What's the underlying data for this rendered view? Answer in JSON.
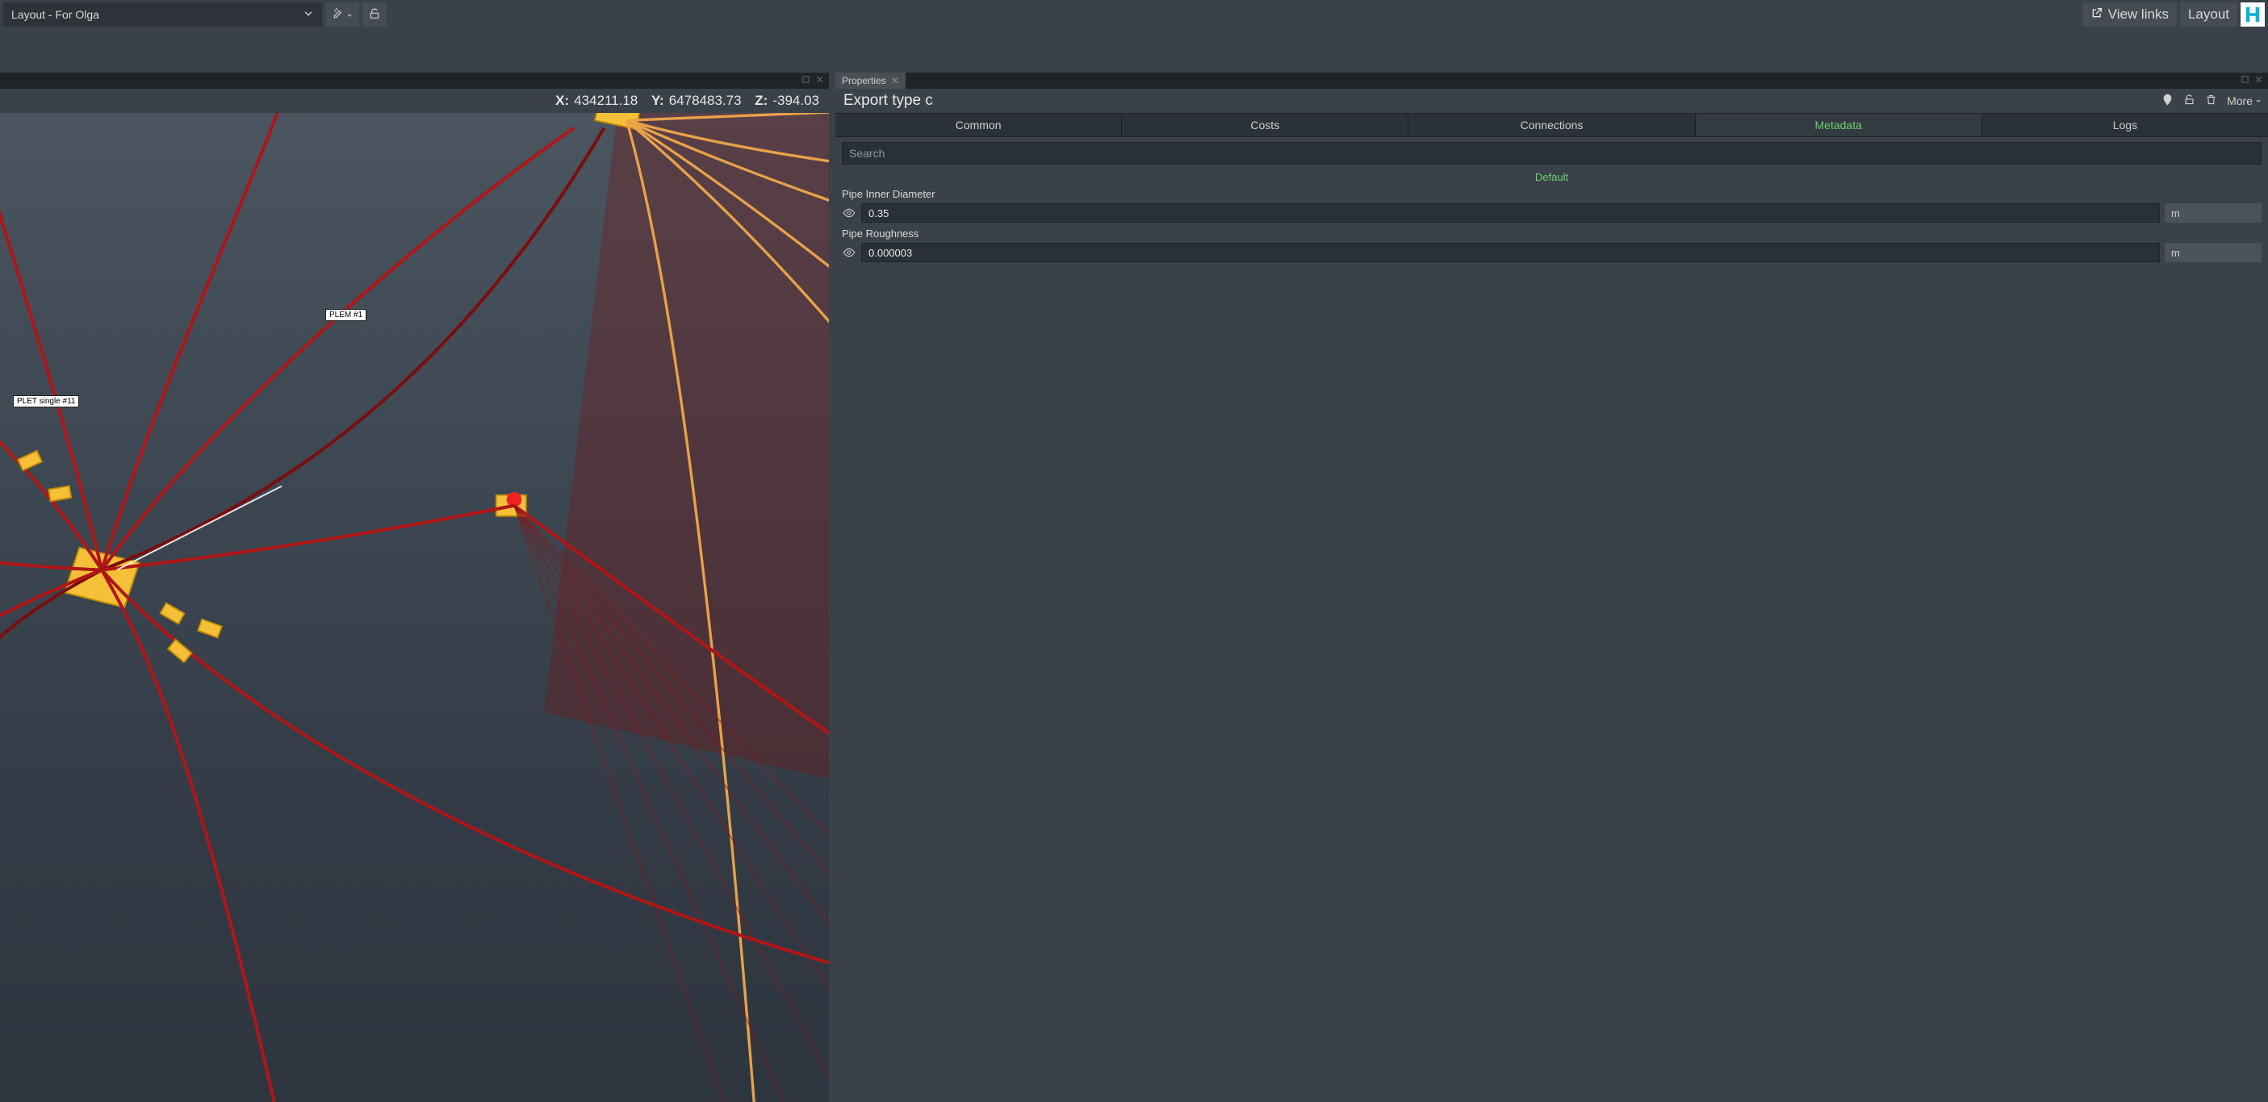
{
  "topbar": {
    "layout_selector": "Layout - For Olga",
    "view_links": "View links",
    "layout_btn": "Layout"
  },
  "viewport": {
    "coords": {
      "x_label": "X:",
      "x_val": "434211.18",
      "y_label": "Y:",
      "y_val": "6478483.73",
      "z_label": "Z:",
      "z_val": "-394.03"
    },
    "labels": {
      "plem1": "PLEM #1",
      "plet_single_11": "PLET single #11"
    }
  },
  "properties_panel": {
    "tab_title": "Properties",
    "title": "Export type c",
    "more_label": "More",
    "tabs": {
      "common": "Common",
      "costs": "Costs",
      "connections": "Connections",
      "metadata": "Metadata",
      "logs": "Logs"
    },
    "search_placeholder": "Search",
    "section_default": "Default",
    "fields": {
      "pipe_inner_diameter": {
        "label": "Pipe Inner Diameter",
        "value": "0.35",
        "unit": "m"
      },
      "pipe_roughness": {
        "label": "Pipe Roughness",
        "value": "0.000003",
        "unit": "m"
      }
    }
  },
  "icons": {
    "chevron_down": "chevron-down-icon",
    "tools": "tools-icon",
    "lock_open": "lock-open-icon",
    "external_link": "external-link-icon",
    "maximize": "maximize-icon",
    "close": "close-icon",
    "pin": "pin-icon",
    "lock": "lock-icon",
    "trash": "trash-icon",
    "eye": "eye-icon"
  }
}
